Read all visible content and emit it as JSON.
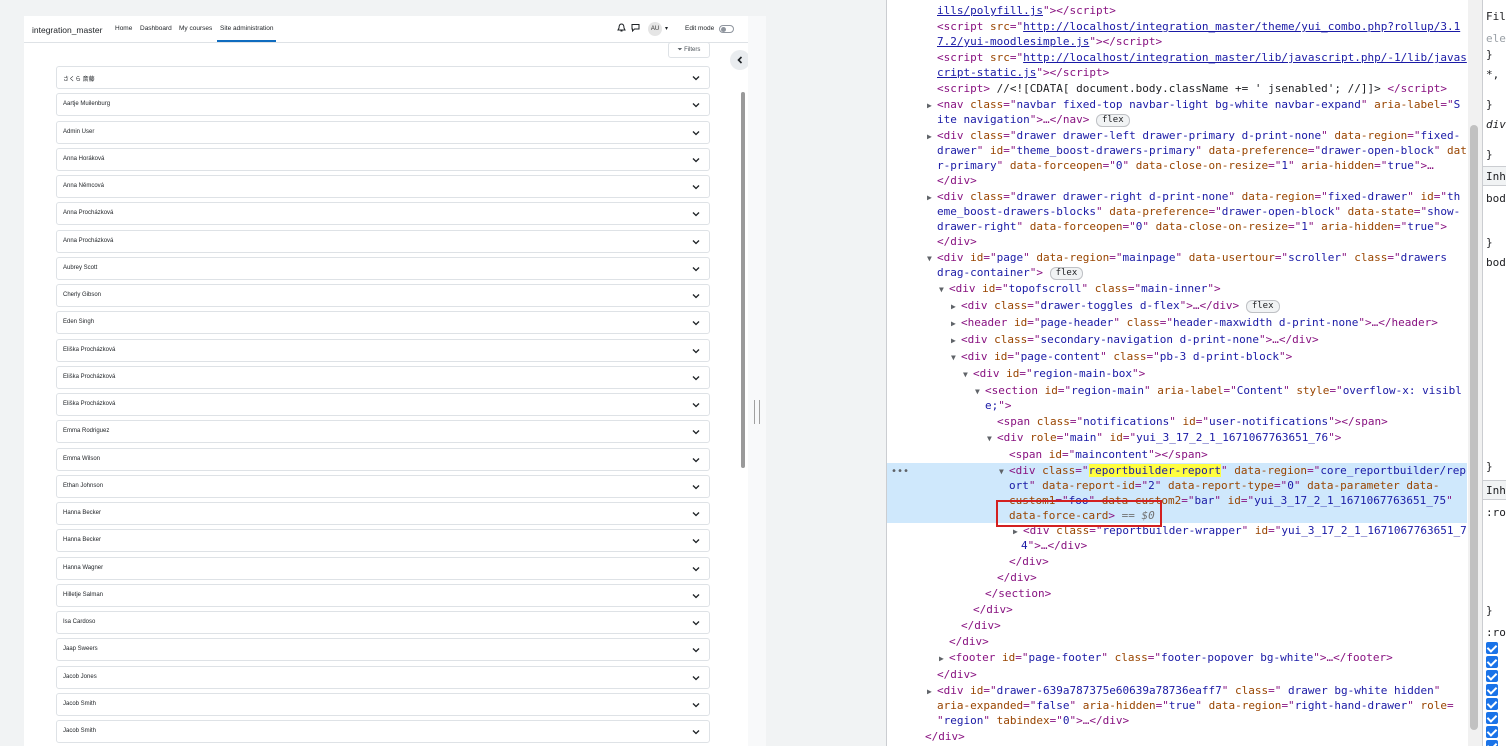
{
  "navbar": {
    "brand": "integration_master",
    "links": [
      "Home",
      "Dashboard",
      "My courses",
      "Site administration"
    ],
    "avatar_initials": "AU",
    "edit_mode_label": "Edit mode"
  },
  "filters_label": "Filters",
  "people": [
    "さくら 斎藤",
    "Aartje Muilenburg",
    "Admin User",
    "Anna Horáková",
    "Anna Němcová",
    "Anna Procházková",
    "Anna Procházková",
    "Aubrey Scott",
    "Cherly Gibson",
    "Eden Singh",
    "Eliška Procházková",
    "Eliška Procházková",
    "Eliška Procházková",
    "Emma Rodriguez",
    "Emma Wilson",
    "Ethan Johnson",
    "Hanna Becker",
    "Hanna Becker",
    "Hanna Wagner",
    "Hilletje Salman",
    "Isa Cardoso",
    "Jaap Sweers",
    "Jacob Jones",
    "Jacob Smith",
    "Jacob Smith"
  ],
  "devtools": {
    "badge_flex": "flex",
    "selected_suffix": "== $0",
    "styles_fragments": [
      "Filt",
      "ele",
      "}",
      "*,",
      "}",
      "div",
      "}",
      "Inh",
      "bod",
      "}",
      "bod",
      "}",
      "Inh",
      ":ro",
      "}",
      ":ro"
    ],
    "lines": [
      {
        "indent": 0,
        "html": "<span class='link'>ills/polyfill.js</span><span class='tag'>\"&gt;&lt;/script&gt;</span>"
      },
      {
        "indent": 0,
        "html": "<span class='tag'>&lt;script </span><span class='attr'>src</span><span class='tag'>=\"</span><span class='link'>http://localhost/integration_master/theme/yui_combo.php?rollup/3.1</span>"
      },
      {
        "indent": 0,
        "html": "<span class='link'>7.2/yui-moodlesimple.js</span><span class='tag'>\"&gt;&lt;/script&gt;</span>"
      },
      {
        "indent": 0,
        "html": "<span class='tag'>&lt;script </span><span class='attr'>src</span><span class='tag'>=\"</span><span class='link'>http://localhost/integration_master/lib/javascript.php/-1/lib/javas</span>"
      },
      {
        "indent": 0,
        "html": "<span class='link'>cript-static.js</span><span class='tag'>\"&gt;&lt;/script&gt;</span>"
      },
      {
        "indent": 0,
        "html": "<span class='tag'>&lt;script&gt;</span><span class='txt'> //&lt;![CDATA[ document.body.className += ' jsenabled'; //]]&gt; </span><span class='tag'>&lt;/script&gt;</span>"
      }
    ]
  }
}
